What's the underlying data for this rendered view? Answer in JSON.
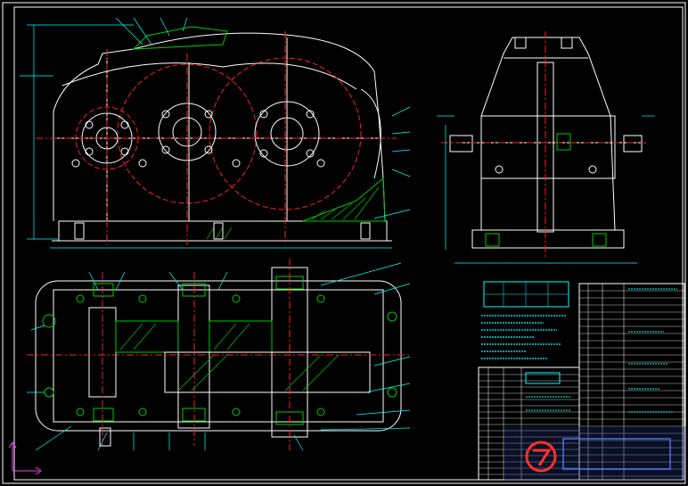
{
  "drawing": {
    "background": "#000000",
    "colors": {
      "frame": "#ffffff",
      "outline": "#ffffff",
      "centerline": "#ff2020",
      "hatch": "#00cc00",
      "dimension": "#00ffff",
      "leader": "#00ffff",
      "text": "#00ffff",
      "axis_x": "#ff40ff",
      "axis_y": "#ff40ff",
      "note": "#ffff00"
    },
    "views": [
      "front-view",
      "side-view",
      "top-section-view",
      "title-block",
      "parts-list"
    ]
  },
  "watermark": {
    "logo_text": "",
    "color": "#3355cc"
  }
}
